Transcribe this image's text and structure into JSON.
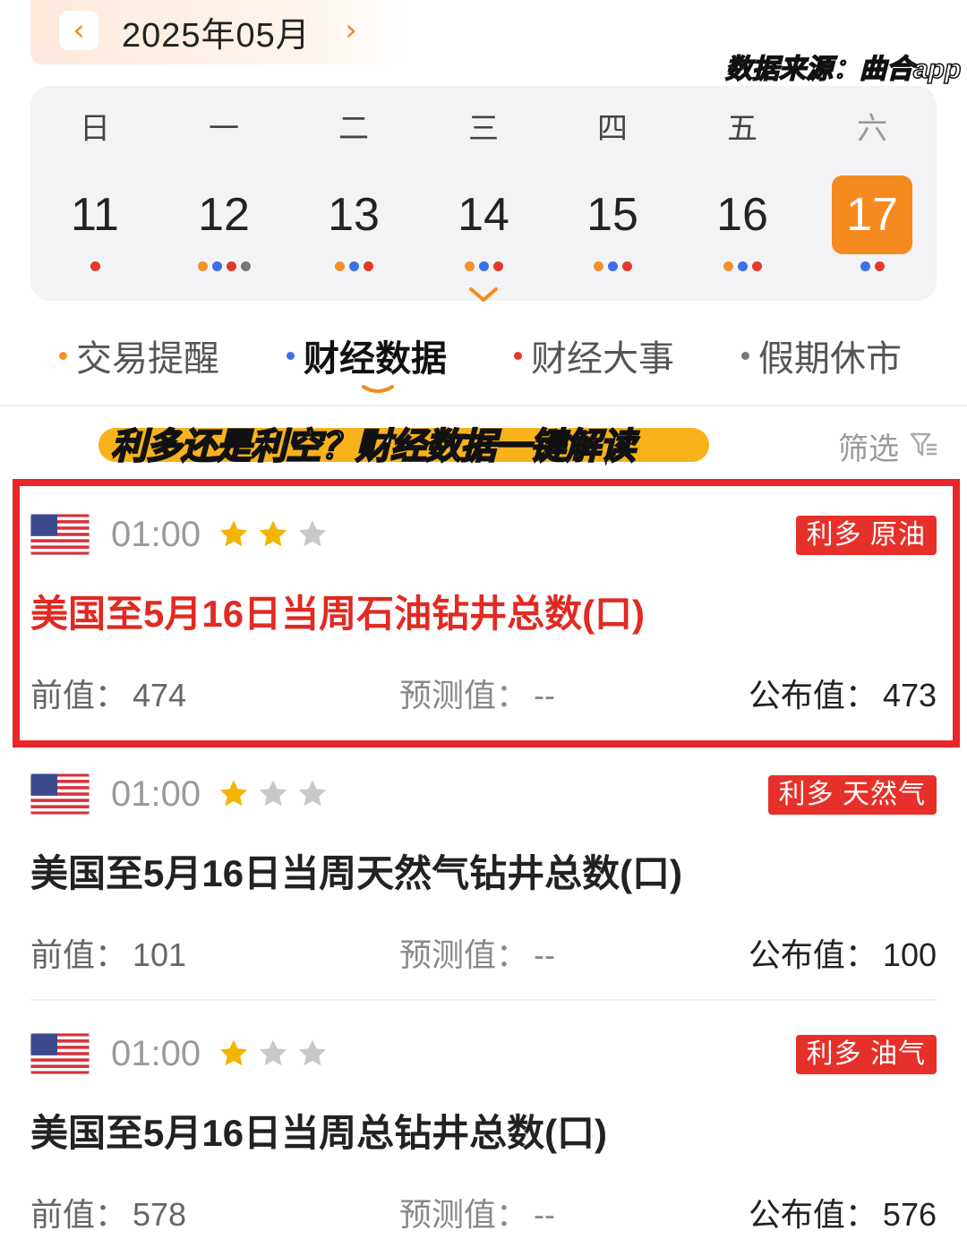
{
  "month": {
    "label": "2025年05月",
    "prev_icon": "chevron-left-icon",
    "next_icon": "chevron-right-icon"
  },
  "source_note": "数据来源：曲合app",
  "weekdays": [
    "日",
    "一",
    "二",
    "三",
    "四",
    "五",
    "六"
  ],
  "days": [
    {
      "num": "11",
      "dots": [
        "red"
      ]
    },
    {
      "num": "12",
      "dots": [
        "orange",
        "blue",
        "red",
        "gray"
      ]
    },
    {
      "num": "13",
      "dots": [
        "orange",
        "blue",
        "red"
      ]
    },
    {
      "num": "14",
      "dots": [
        "orange",
        "blue",
        "red"
      ]
    },
    {
      "num": "15",
      "dots": [
        "orange",
        "blue",
        "red"
      ]
    },
    {
      "num": "16",
      "dots": [
        "orange",
        "blue",
        "red"
      ]
    },
    {
      "num": "17",
      "dots": [
        "blue",
        "red"
      ],
      "selected": true
    }
  ],
  "tabs": [
    {
      "label": "交易提醒",
      "bullet_color": "#f5902a",
      "active": false
    },
    {
      "label": "财经数据",
      "bullet_color": "#3d6fe6",
      "active": true
    },
    {
      "label": "财经大事",
      "bullet_color": "#e33a2a",
      "active": false
    },
    {
      "label": "假期休市",
      "bullet_color": "#777777",
      "active": false
    }
  ],
  "banner": {
    "text": "利多还是利空？财经数据一键解读"
  },
  "filter": {
    "label": "筛选",
    "icon": "filter-icon"
  },
  "colors": {
    "accent_orange": "#f58a1f",
    "tag_red": "#e8302a",
    "highlight_red": "#e8262b",
    "star_gold": "#f5b400",
    "star_gray": "#c8c8c8"
  },
  "labels": {
    "prev": "前值：",
    "forecast": "预测值：",
    "actual": "公布值："
  },
  "events": [
    {
      "flag": "us-flag-icon",
      "time": "01:00",
      "stars": 2,
      "tag": "利多 原油",
      "title": "美国至5月16日当周石油钻井总数(口)",
      "prev": "474",
      "forecast": "--",
      "actual": "473",
      "highlighted": true
    },
    {
      "flag": "us-flag-icon",
      "time": "01:00",
      "stars": 1,
      "tag": "利多 天然气",
      "title": "美国至5月16日当周天然气钻井总数(口)",
      "prev": "101",
      "forecast": "--",
      "actual": "100",
      "highlighted": false
    },
    {
      "flag": "us-flag-icon",
      "time": "01:00",
      "stars": 1,
      "tag": "利多 油气",
      "title": "美国至5月16日当周总钻井总数(口)",
      "prev": "578",
      "forecast": "--",
      "actual": "576",
      "highlighted": false
    }
  ]
}
